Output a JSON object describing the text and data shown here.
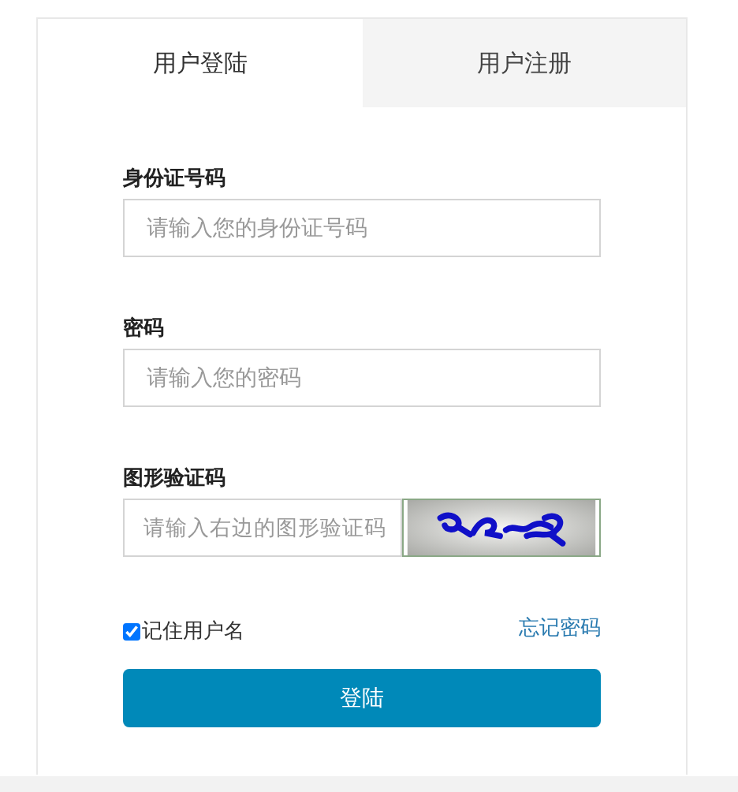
{
  "tabs": [
    {
      "label": "用户登陆",
      "selected": true
    },
    {
      "label": "用户注册",
      "selected": false
    }
  ],
  "fields": [
    {
      "label": "身份证号码",
      "placeholder": "请输入您的身份证号码",
      "kind": "text"
    },
    {
      "label": "密码",
      "placeholder": "请输入您的密码",
      "kind": "password"
    },
    {
      "label": "图形验证码",
      "placeholder": "请输入右边的图形验证码",
      "kind": "captcha"
    }
  ],
  "remember": {
    "label": "记住用户名",
    "checked": true
  },
  "forgot_link": "忘记密码",
  "submit": "登陆"
}
